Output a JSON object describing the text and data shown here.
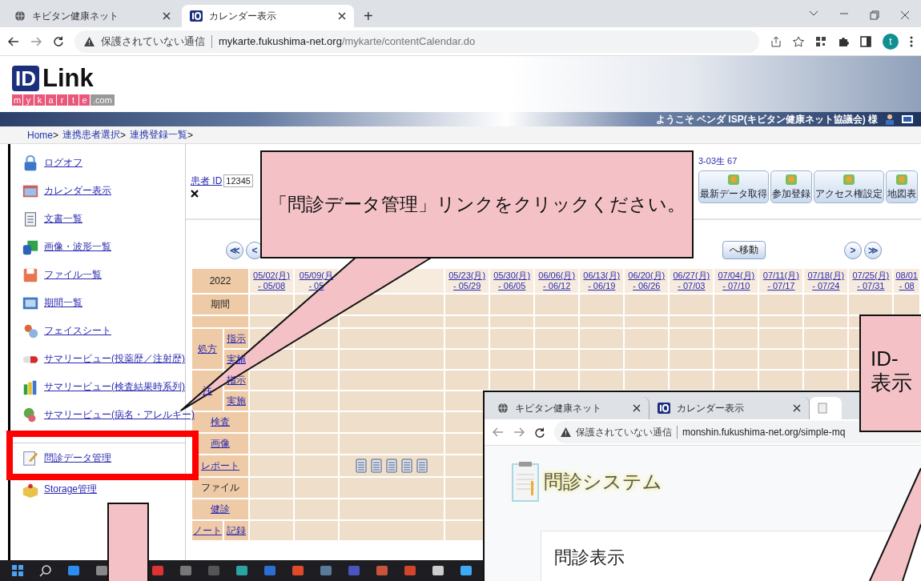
{
  "browser": {
    "tabs": [
      {
        "label": "キビタン健康ネット",
        "selected": false
      },
      {
        "label": "カレンダー表示",
        "selected": true
      }
    ],
    "new_tab": "+",
    "security": "保護されていない通信",
    "url_host": "mykarte.fukushima-net.org",
    "url_path": "/mykarte/contentCalendar.do",
    "avatar": "t"
  },
  "header": {
    "logo_mark": "ID",
    "logo_word": "Link",
    "logo_letters": [
      "m",
      "y",
      "k",
      "a",
      "r",
      "t",
      "e",
      ".com"
    ],
    "welcome": "ようこそ ベンダ ISP(キビタン健康ネット協議会) 様"
  },
  "breadcrumb": [
    {
      "label": "Home",
      "separator": " >"
    },
    {
      "label": "連携患者選択",
      "separator": ">"
    },
    {
      "label": "連携登録一覧",
      "separator": ">"
    }
  ],
  "sidebar": {
    "items": [
      {
        "kind": "lock",
        "label": "ログオフ",
        "separated": false
      },
      {
        "kind": "calendar",
        "label": "カレンダー表示",
        "separated": false
      },
      {
        "kind": "document",
        "label": "文書一覧",
        "separated": false
      },
      {
        "kind": "grid",
        "label": "画像・波形一覧",
        "separated": false
      },
      {
        "kind": "floppy",
        "label": "ファイル一覧",
        "separated": false
      },
      {
        "kind": "picture",
        "label": "期間一覧",
        "separated": false
      },
      {
        "kind": "people",
        "label": "フェイスシート",
        "separated": false
      },
      {
        "kind": "capsule",
        "label": "サマリービュー(投薬歴／注射歴)",
        "separated": false
      },
      {
        "kind": "chart",
        "label": "サマリービュー(検査結果時系列)",
        "separated": false
      },
      {
        "kind": "person",
        "label": "サマリービュー(病名・アレルギー)",
        "separated": false
      },
      {
        "kind": "notepad",
        "label": "問診データ管理",
        "separated": true
      },
      {
        "kind": "box",
        "label": "Storage管理",
        "separated": false
      }
    ]
  },
  "patient": {
    "id_label": "患者 ID",
    "id_value": "12345",
    "birth_info": "3-03生 67",
    "buttons": [
      "最新データ取得",
      "参加登録",
      "アクセス権設定",
      "地図表"
    ]
  },
  "navigation": {
    "first": "≪",
    "previous": "<",
    "move": "へ移動",
    "next": ">",
    "last": "≫"
  },
  "calendar": {
    "year": "2022",
    "columns": [
      {
        "wide": false,
        "date": "05/02(月)",
        "range": "- 05/08"
      },
      {
        "wide": false,
        "date": "05/09(月",
        "range": "- 05"
      },
      {
        "wide": true
      },
      {
        "wide": false,
        "date": "05/23(月)",
        "range": "- 05/29"
      },
      {
        "wide": false,
        "date": "05/30(月)",
        "range": "- 06/05"
      },
      {
        "wide": false,
        "date": "06/06(月)",
        "range": "- 06/12"
      },
      {
        "wide": false,
        "date": "06/13(月)",
        "range": "- 06/19"
      },
      {
        "wide": false,
        "date": "06/20(月)",
        "range": "- 06/26"
      },
      {
        "wide": false,
        "date": "06/27(月)",
        "range": "- 07/03"
      },
      {
        "wide": false,
        "date": "07/04(月)",
        "range": "- 07/10"
      },
      {
        "wide": false,
        "date": "07/11(月)",
        "range": "- 07/17"
      },
      {
        "wide": false,
        "date": "07/18(月)",
        "range": "- 07/24"
      },
      {
        "wide": false,
        "date": "07/25(月)",
        "range": "- 07/31"
      },
      {
        "wide": false,
        "date": "08/01",
        "range": "- 08"
      }
    ],
    "rows": [
      {
        "kind": "single",
        "label": "期間",
        "link": false
      },
      {
        "kind": "spacer"
      },
      {
        "kind": "group",
        "label": "処方",
        "link": true,
        "children": [
          "指示",
          "実施"
        ]
      },
      {
        "kind": "group",
        "label": "注",
        "link": true,
        "children": [
          "指示",
          "実施"
        ]
      },
      {
        "kind": "single",
        "label": "検査",
        "link": true
      },
      {
        "kind": "single",
        "label": "画像",
        "link": true
      },
      {
        "kind": "documents",
        "label": "レポート",
        "link": true,
        "icons": [
          {
            "kind": "doc"
          },
          {
            "kind": "doc"
          },
          {
            "kind": "doc"
          },
          {
            "kind": "doc"
          },
          {
            "kind": "doc"
          }
        ]
      },
      {
        "kind": "single",
        "label": "ファイル",
        "link": false
      },
      {
        "kind": "single",
        "label": "健診",
        "link": true
      },
      {
        "kind": "group",
        "label": "ノート",
        "link": true,
        "children": [
          "記録"
        ]
      }
    ]
  },
  "inset_window": {
    "tabs": [
      {
        "label": "キビタン健康ネット",
        "selected": false
      },
      {
        "label": "カレンダー表示",
        "selected": false
      },
      {
        "selected": true
      }
    ],
    "security": "保護されていない通信",
    "url": "monshin.fukushima-net.org/simple-mq",
    "app_title": "問診システム",
    "card_title": "問診表示"
  },
  "instruction_callout": {
    "text": "「問診データ管理」リンクをクリックください。"
  },
  "side_callout": {
    "lines": [
      "ID-",
      "表示"
    ]
  }
}
